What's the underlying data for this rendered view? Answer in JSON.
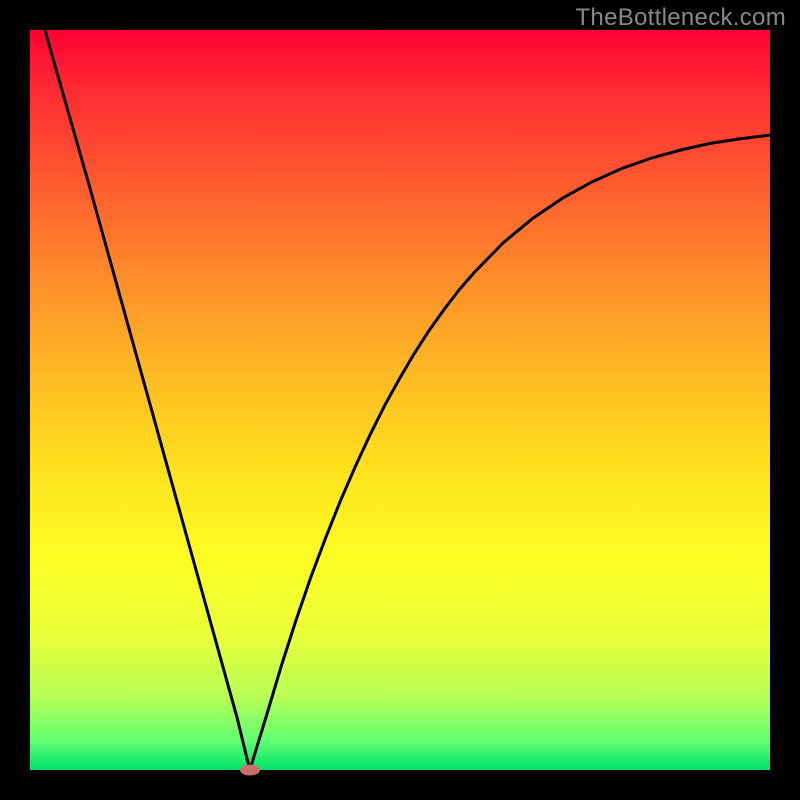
{
  "watermark": "TheBottleneck.com",
  "colors": {
    "frame": "#000000",
    "curve": "#000000",
    "marker": "#cc6f6a"
  },
  "chart_data": {
    "type": "line",
    "title": "",
    "xlabel": "",
    "ylabel": "",
    "xlim": [
      0,
      100
    ],
    "ylim": [
      0,
      100
    ],
    "grid": false,
    "series": [
      {
        "name": "bottleneck-curve",
        "x": [
          2,
          4,
          6,
          8,
          10,
          12,
          14,
          16,
          18,
          20,
          22,
          24,
          26,
          28,
          29.7,
          32,
          34,
          36,
          38,
          40,
          42,
          44,
          46,
          48,
          50,
          52,
          54,
          56,
          58,
          60,
          64,
          68,
          72,
          76,
          80,
          84,
          88,
          92,
          96,
          100
        ],
        "y": [
          100,
          93,
          86,
          79,
          71.8,
          64.6,
          57.4,
          50.2,
          43,
          35.8,
          28.6,
          21.4,
          14.2,
          7,
          0,
          7.5,
          14.2,
          20.4,
          26.2,
          31.5,
          36.5,
          41.1,
          45.4,
          49.4,
          53,
          56.4,
          59.5,
          62.3,
          64.9,
          67.2,
          71.3,
          74.6,
          77.3,
          79.5,
          81.3,
          82.7,
          83.8,
          84.7,
          85.3,
          85.8
        ]
      }
    ],
    "annotations": [
      {
        "name": "min-marker",
        "x": 29.7,
        "y": 0
      }
    ]
  }
}
